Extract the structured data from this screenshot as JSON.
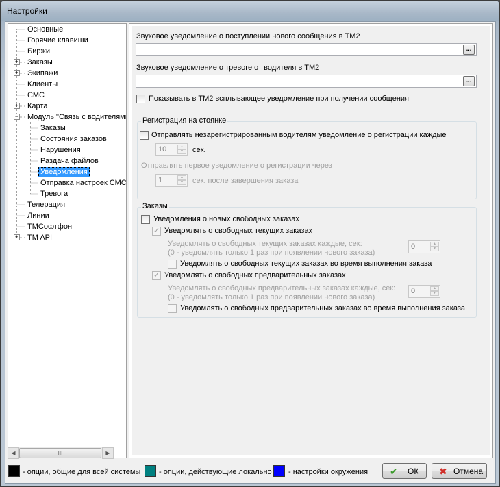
{
  "window": {
    "title": "Настройки"
  },
  "tree": {
    "items": [
      {
        "label": "Основные"
      },
      {
        "label": "Горячие клавиши"
      },
      {
        "label": "Биржи"
      },
      {
        "label": "Заказы"
      },
      {
        "label": "Экипажи"
      },
      {
        "label": "Клиенты"
      },
      {
        "label": "СМС"
      },
      {
        "label": "Карта"
      },
      {
        "label": "Модуль \"Связь с водителями"
      },
      {
        "label": "Заказы"
      },
      {
        "label": "Состояния заказов"
      },
      {
        "label": "Нарушения"
      },
      {
        "label": "Раздача файлов"
      },
      {
        "label": "Уведомления"
      },
      {
        "label": "Отправка настроек СМС"
      },
      {
        "label": "Тревога"
      },
      {
        "label": "Телерация"
      },
      {
        "label": "Линии"
      },
      {
        "label": "ТМСофтфон"
      },
      {
        "label": "TM API"
      }
    ],
    "scroll_grip": "III"
  },
  "settings": {
    "sound_new_message_label": "Звуковое уведомление о поступлении нового сообщения в ТМ2",
    "sound_new_message_value": "",
    "sound_alarm_label": "Звуковое уведомление о тревоге от водителя в ТМ2",
    "sound_alarm_value": "",
    "browse_label": "...",
    "show_popup_label": "Показывать в ТМ2 всплывающее уведомление при получении сообщения",
    "parking": {
      "title": "Регистрация на стоянке",
      "send_unregistered_label": "Отправлять незарегистрированным водителям уведомление о регистрации каждые",
      "interval_value": "10",
      "interval_unit": "сек.",
      "first_label": "Отправлять первое уведомление о регистрации через",
      "first_value": "1",
      "first_unit": "сек. после завершения заказа"
    },
    "orders": {
      "title": "Заказы",
      "new_free_label": "Уведомления о новых свободных заказах",
      "current_label": "Уведомлять о свободных текущих заказах",
      "current_interval_label_1": "Уведомлять о свободных текущих заказах каждые, сек:",
      "current_interval_label_2": "(0 - уведомлять только 1 раз при появлении нового заказа)",
      "current_interval_value": "0",
      "current_during_label": "Уведомлять о свободных текущих заказах во время выполнения заказа",
      "prelim_label": "Уведомлять о свободных предварительных заказах",
      "prelim_interval_label_1": "Уведомлять о свободных предварительных заказах каждые, сек:",
      "prelim_interval_label_2": "(0 - уведомлять только 1 раз при появлении нового заказа)",
      "prelim_interval_value": "0",
      "prelim_during_label": "Уведомлять о свободных предварительных заказах во время выполнения заказа"
    }
  },
  "footer": {
    "legend_global": "- опции, общие для всей системы",
    "legend_local": "- опции, действующие локально",
    "legend_env": "- настройки окружения",
    "ok_label": "ОК",
    "cancel_label": "Отмена"
  },
  "colors": {
    "global": "#000000",
    "local": "#008080",
    "env": "#0000ff",
    "selection": "#3399ff"
  }
}
